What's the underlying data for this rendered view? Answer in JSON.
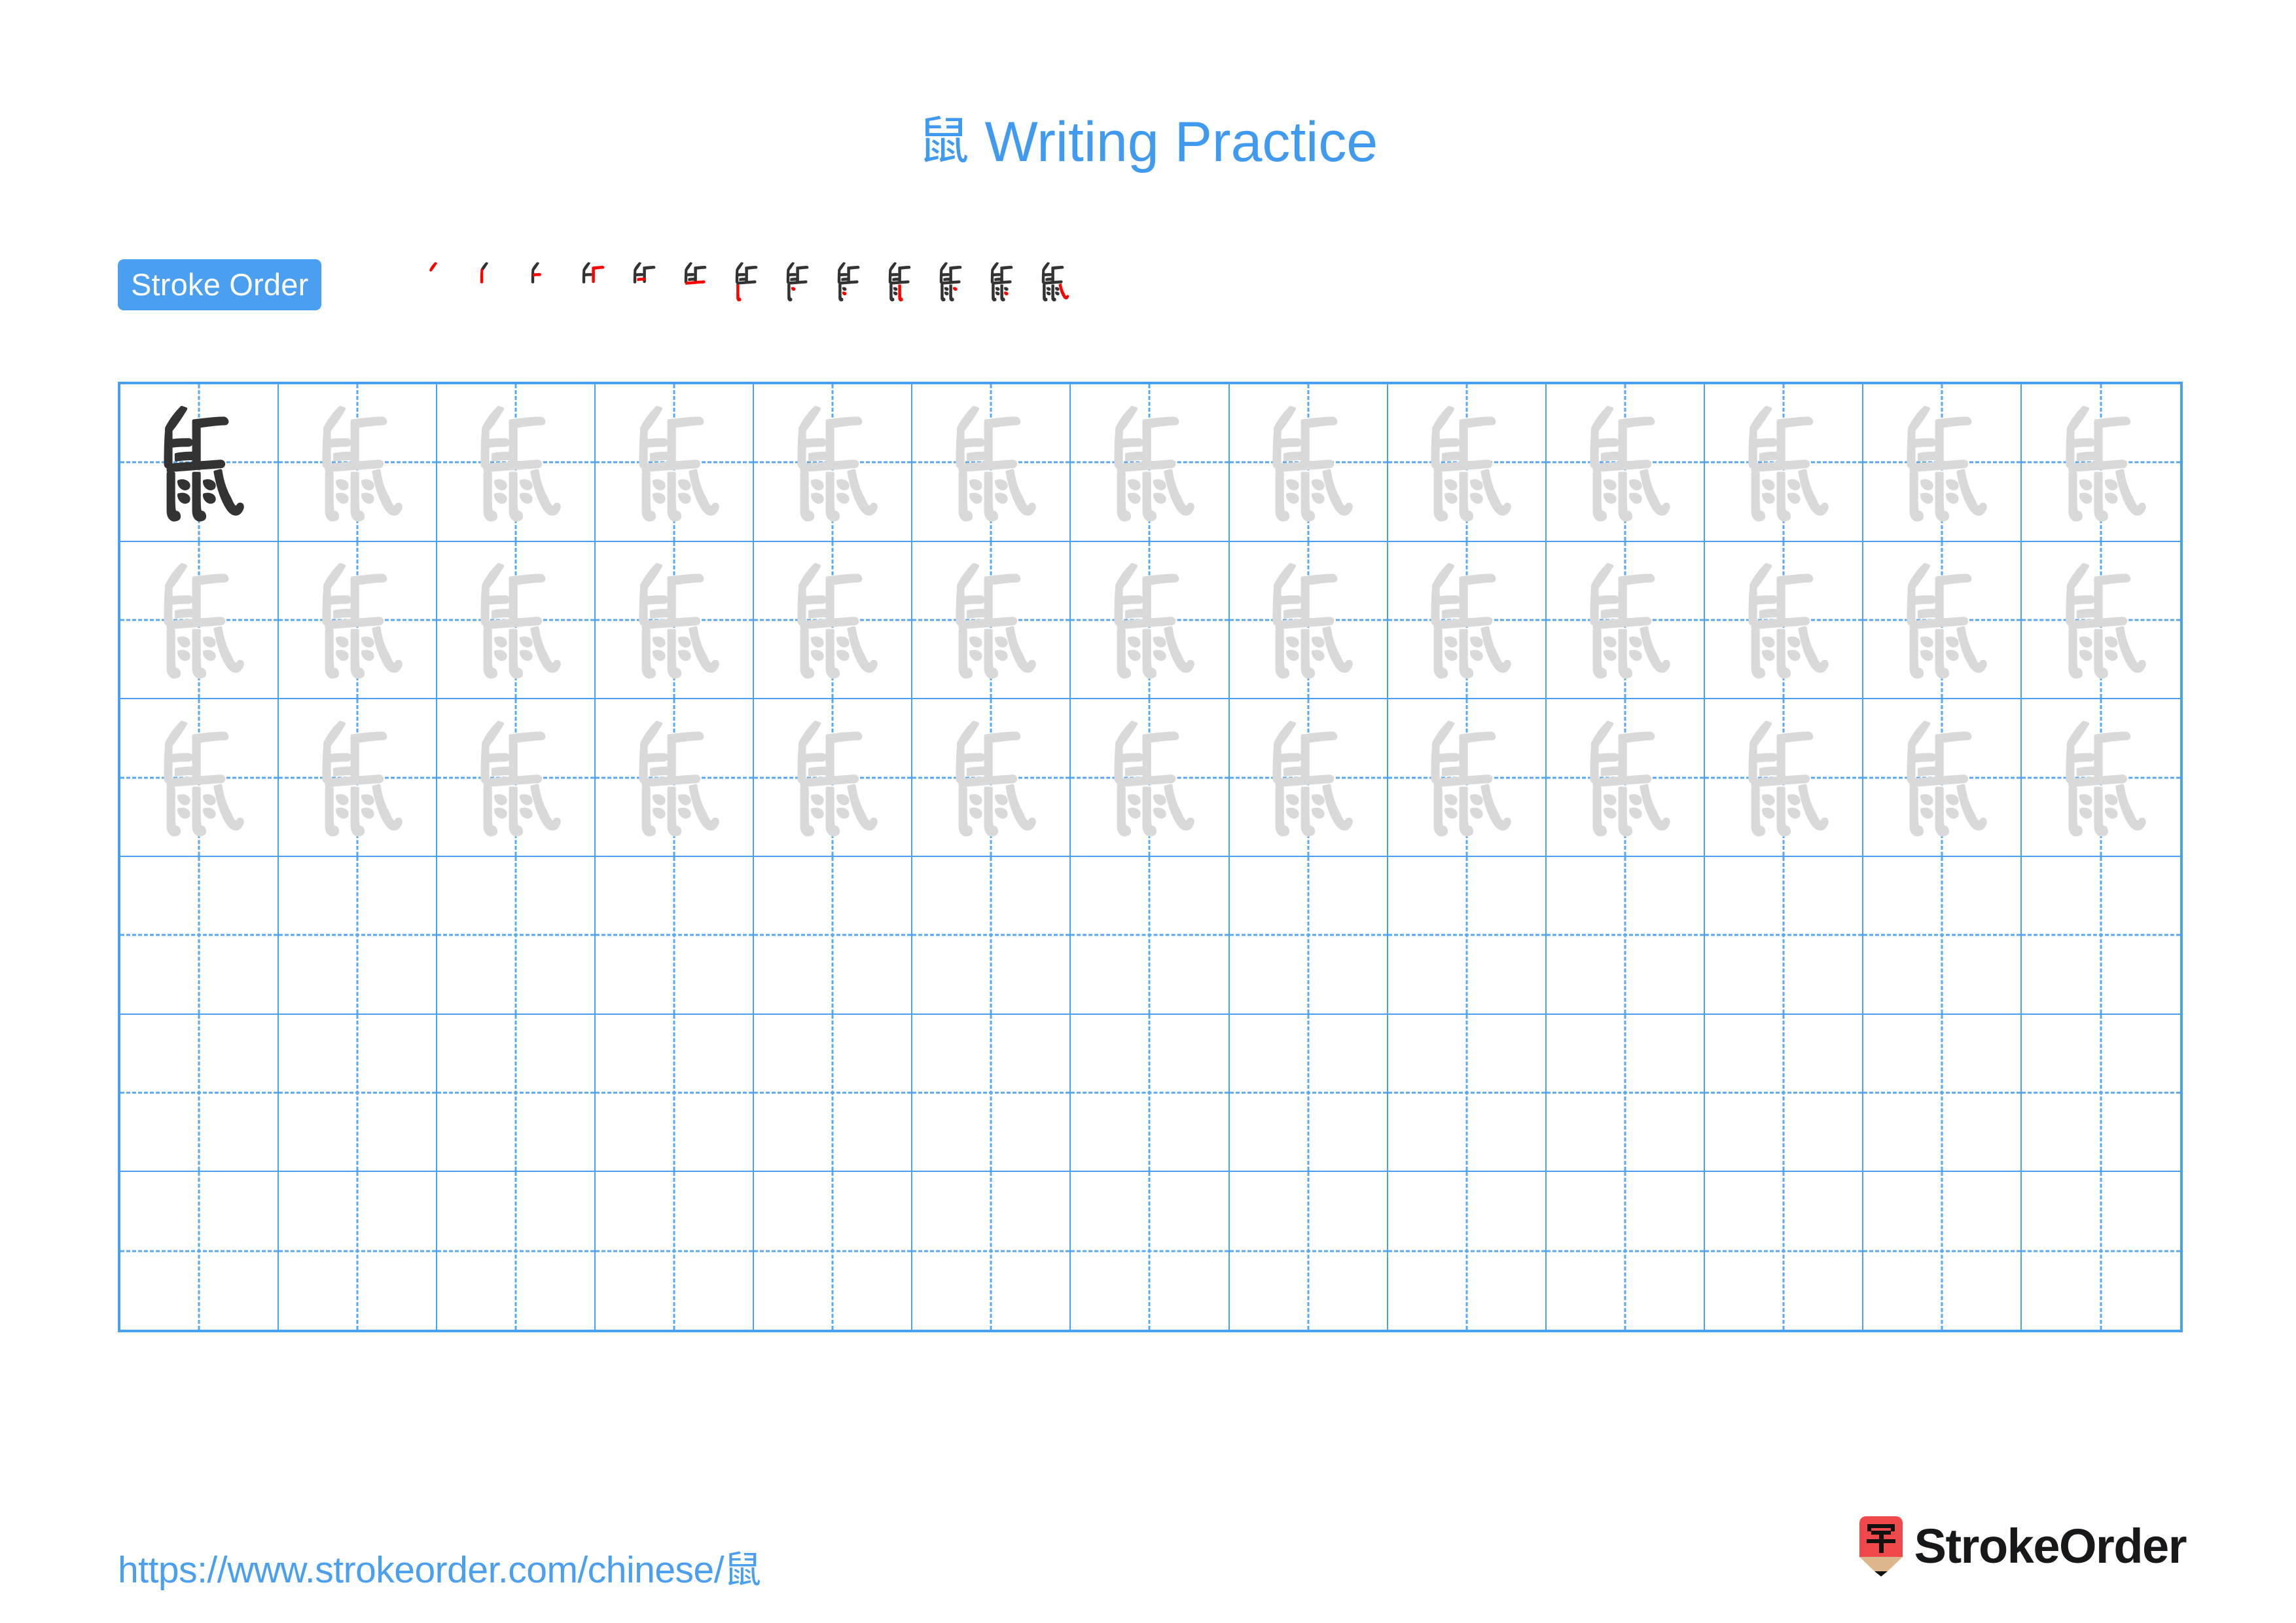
{
  "character": "鼠",
  "colors": {
    "accent_blue": "#4a9ff0",
    "title_blue": "#409bf0",
    "grid_line": "#4a9ff0",
    "guide_dash": "#5aa8f2",
    "stroke_drawn": "#333333",
    "stroke_new": "#ff0000",
    "trace_gray": "#d9d9d9",
    "logo_red": "#f1484b",
    "logo_tan": "#ddb68b",
    "logo_text": "#17181a"
  },
  "header": {
    "title_character": "鼠",
    "title_text": " Writing Practice"
  },
  "stroke_order": {
    "badge_label": "Stroke Order",
    "total_strokes": 13,
    "steps": [
      1,
      2,
      3,
      4,
      5,
      6,
      7,
      8,
      9,
      10,
      11,
      12,
      13
    ]
  },
  "practice_grid": {
    "columns": 13,
    "rows": 6,
    "filled_rows": 3,
    "empty_rows": 3,
    "model_cell": {
      "row": 1,
      "column": 1,
      "style": "dark"
    },
    "trace_style": "light-gray",
    "row_cells": [
      [
        "dark",
        "trace",
        "trace",
        "trace",
        "trace",
        "trace",
        "trace",
        "trace",
        "trace",
        "trace",
        "trace",
        "trace",
        "trace"
      ],
      [
        "trace",
        "trace",
        "trace",
        "trace",
        "trace",
        "trace",
        "trace",
        "trace",
        "trace",
        "trace",
        "trace",
        "trace",
        "trace"
      ],
      [
        "trace",
        "trace",
        "trace",
        "trace",
        "trace",
        "trace",
        "trace",
        "trace",
        "trace",
        "trace",
        "trace",
        "trace",
        "trace"
      ],
      [
        "empty",
        "empty",
        "empty",
        "empty",
        "empty",
        "empty",
        "empty",
        "empty",
        "empty",
        "empty",
        "empty",
        "empty",
        "empty"
      ],
      [
        "empty",
        "empty",
        "empty",
        "empty",
        "empty",
        "empty",
        "empty",
        "empty",
        "empty",
        "empty",
        "empty",
        "empty",
        "empty"
      ],
      [
        "empty",
        "empty",
        "empty",
        "empty",
        "empty",
        "empty",
        "empty",
        "empty",
        "empty",
        "empty",
        "empty",
        "empty",
        "empty"
      ]
    ]
  },
  "footer": {
    "url": "https://www.strokeorder.com/chinese/鼠",
    "url_prefix": "https://www.strokeorder.com/chinese/",
    "url_character": "鼠",
    "logo_character": "字",
    "logo_text": "StrokeOrder"
  }
}
